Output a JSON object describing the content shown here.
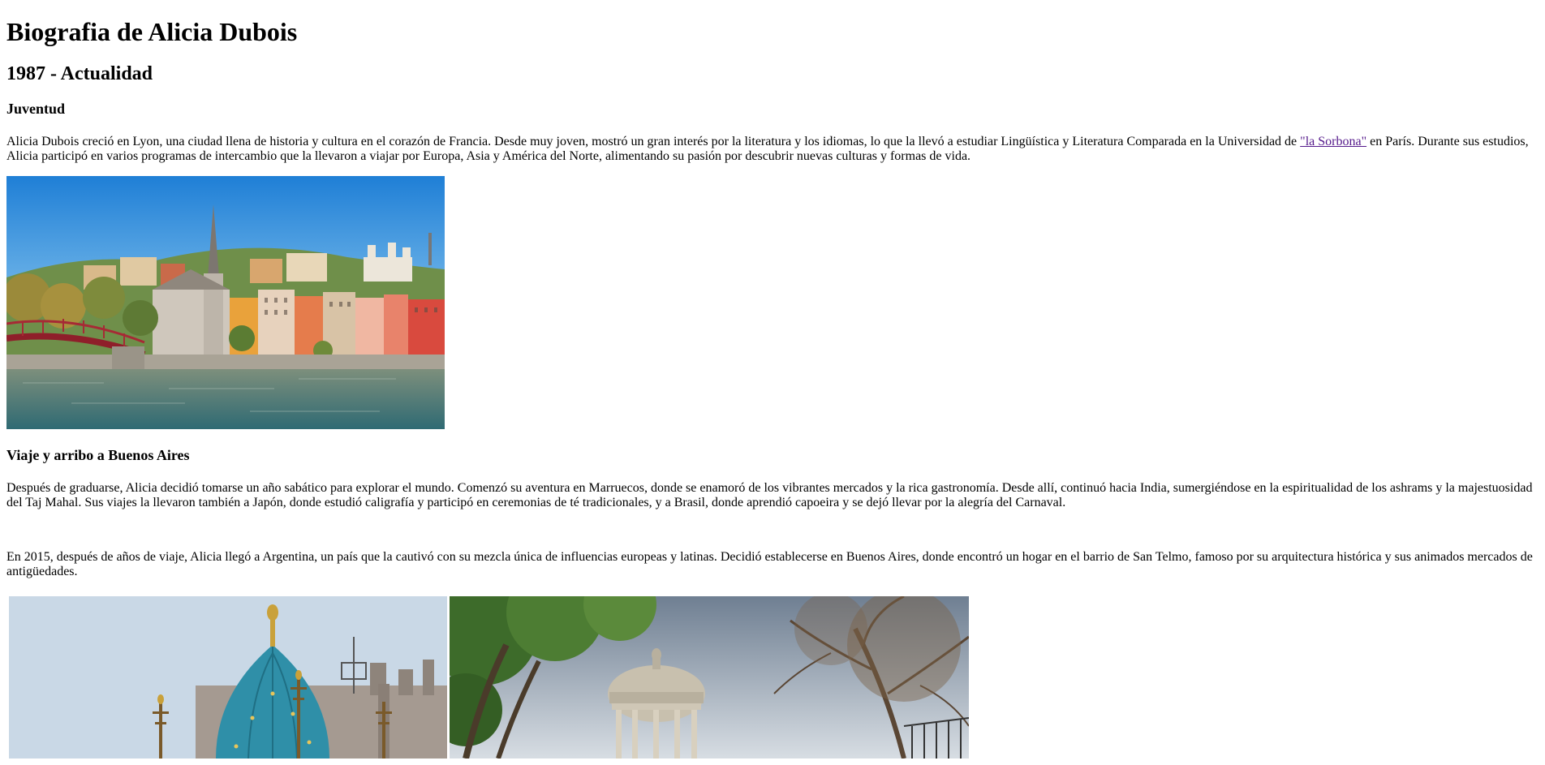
{
  "title": "Biografia de Alicia Dubois",
  "period": "1987 - Actualidad",
  "sections": {
    "youth": {
      "heading": "Juventud",
      "text_before_link": "Alicia Dubois creció en Lyon, una ciudad llena de historia y cultura en el corazón de Francia. Desde muy joven, mostró un gran interés por la literatura y los idiomas, lo que la llevó a estudiar Lingüística y Literatura Comparada en la Universidad de ",
      "link_text": "\"la Sorbona\"",
      "text_after_link": " en París. Durante sus estudios, Alicia participó en varios programas de intercambio que la llevaron a viajar por Europa, Asia y América del Norte, alimentando su pasión por descubrir nuevas culturas y formas de vida."
    },
    "travel": {
      "heading": "Viaje y arribo a Buenos Aires",
      "paragraph1": "Después de graduarse, Alicia decidió tomarse un año sabático para explorar el mundo. Comenzó su aventura en Marruecos, donde se enamoró de los vibrantes mercados y la rica gastronomía. Desde allí, continuó hacia India, sumergiéndose en la espiritualidad de los ashrams y la majestuosidad del Taj Mahal. Sus viajes la llevaron también a Japón, donde estudió caligrafía y participó en ceremonias de té tradicionales, y a Brasil, donde aprendió capoeira y se dejó llevar por la alegría del Carnaval.",
      "paragraph2": "En 2015, después de años de viaje, Alicia llegó a Argentina, un país que la cautivó con su mezcla única de influencias europeas y latinas. Decidió establecerse en Buenos Aires, donde encontró un hogar en el barrio de San Telmo, famoso por su arquitectura histórica y sus animados mercados de antigüedades."
    }
  },
  "colors": {
    "link": "#551a8b"
  }
}
